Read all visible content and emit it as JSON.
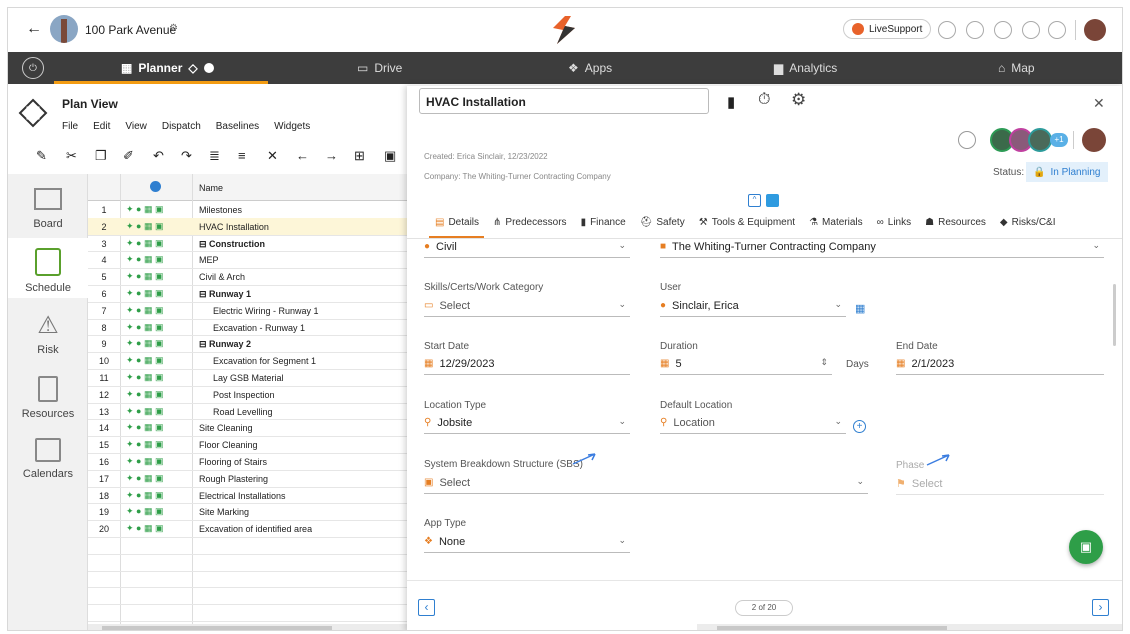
{
  "header": {
    "title": "100 Park Avenue",
    "live_support": "LiveSupport"
  },
  "nav": {
    "tabs": [
      {
        "label": "Planner"
      },
      {
        "label": "Drive"
      },
      {
        "label": "Apps"
      },
      {
        "label": "Analytics"
      },
      {
        "label": "Map"
      }
    ]
  },
  "plan": {
    "title": "Plan View",
    "menus": [
      "File",
      "Edit",
      "View",
      "Dispatch",
      "Baselines",
      "Widgets"
    ]
  },
  "rail": [
    {
      "label": "Board"
    },
    {
      "label": "Schedule"
    },
    {
      "label": "Risk"
    },
    {
      "label": "Resources"
    },
    {
      "label": "Calendars"
    }
  ],
  "grid": {
    "name_header": "Name",
    "rows": [
      {
        "n": "1",
        "name": "Milestones"
      },
      {
        "n": "2",
        "name": "HVAC Installation"
      },
      {
        "n": "3",
        "name": "Construction"
      },
      {
        "n": "4",
        "name": "MEP"
      },
      {
        "n": "5",
        "name": "Civil & Arch"
      },
      {
        "n": "6",
        "name": "Runway 1"
      },
      {
        "n": "7",
        "name": "Electric Wiring - Runway 1"
      },
      {
        "n": "8",
        "name": "Excavation - Runway 1"
      },
      {
        "n": "9",
        "name": "Runway 2"
      },
      {
        "n": "10",
        "name": "Excavation for Segment 1"
      },
      {
        "n": "11",
        "name": "Lay GSB Material"
      },
      {
        "n": "12",
        "name": "Post Inspection"
      },
      {
        "n": "13",
        "name": "Road Levelling"
      },
      {
        "n": "14",
        "name": "Site Cleaning"
      },
      {
        "n": "15",
        "name": "Floor Cleaning"
      },
      {
        "n": "16",
        "name": "Flooring of Stairs"
      },
      {
        "n": "17",
        "name": "Rough Plastering"
      },
      {
        "n": "18",
        "name": "Electrical Installations"
      },
      {
        "n": "19",
        "name": "Site Marking"
      },
      {
        "n": "20",
        "name": "Excavation of identified area"
      }
    ]
  },
  "panel": {
    "task_name": "HVAC Installation",
    "created": "Created:  Erica Sinclair, 12/23/2022",
    "company": "Company: The Whiting-Turner Contracting Company",
    "status_label": "Status:",
    "status": "In Planning",
    "avatar_more": "+1",
    "tabs": [
      "Details",
      "Predecessors",
      "Finance",
      "Safety",
      "Tools & Equipment",
      "Materials",
      "Links",
      "Resources",
      "Risks/C&I"
    ],
    "trade": "Civil",
    "company_value": "The Whiting-Turner Contracting Company",
    "skills_label": "Skills/Certs/Work Category",
    "skills_value": "Select",
    "user_label": "User",
    "user_value": "Sinclair, Erica",
    "start_label": "Start Date",
    "start_value": "12/29/2023",
    "duration_label": "Duration",
    "duration_value": "5",
    "duration_unit": "Days",
    "end_label": "End Date",
    "end_value": "2/1/2023",
    "loc_type_label": "Location Type",
    "loc_type_value": "Jobsite",
    "def_loc_label": "Default Location",
    "def_loc_value": "Location",
    "sbs_label": "System Breakdown Structure (SBS)",
    "sbs_value": "Select",
    "phase_label": "Phase",
    "phase_value": "Select",
    "app_type_label": "App Type",
    "app_type_value": "None",
    "pager": "2 of 20"
  }
}
